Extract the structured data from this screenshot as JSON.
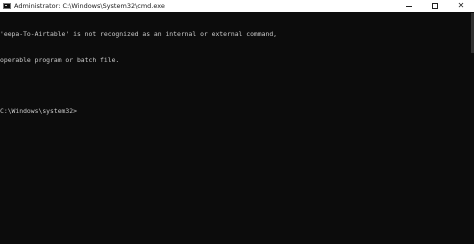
{
  "window": {
    "title": "Administrator: C:\\Windows\\System32\\cmd.exe",
    "icon": "cmd-icon",
    "controls": {
      "minimize": "minimize-icon",
      "maximize": "maximize-icon",
      "close": "close-icon"
    }
  },
  "console": {
    "lines": [
      "'eepa-To-Airtable' is not recognized as an internal or external command,",
      "operable program or batch file.",
      "",
      "C:\\Windows\\system32>"
    ]
  },
  "colors": {
    "background": "#0c0c0c",
    "text": "#cccccc",
    "titlebar": "#ffffff"
  }
}
